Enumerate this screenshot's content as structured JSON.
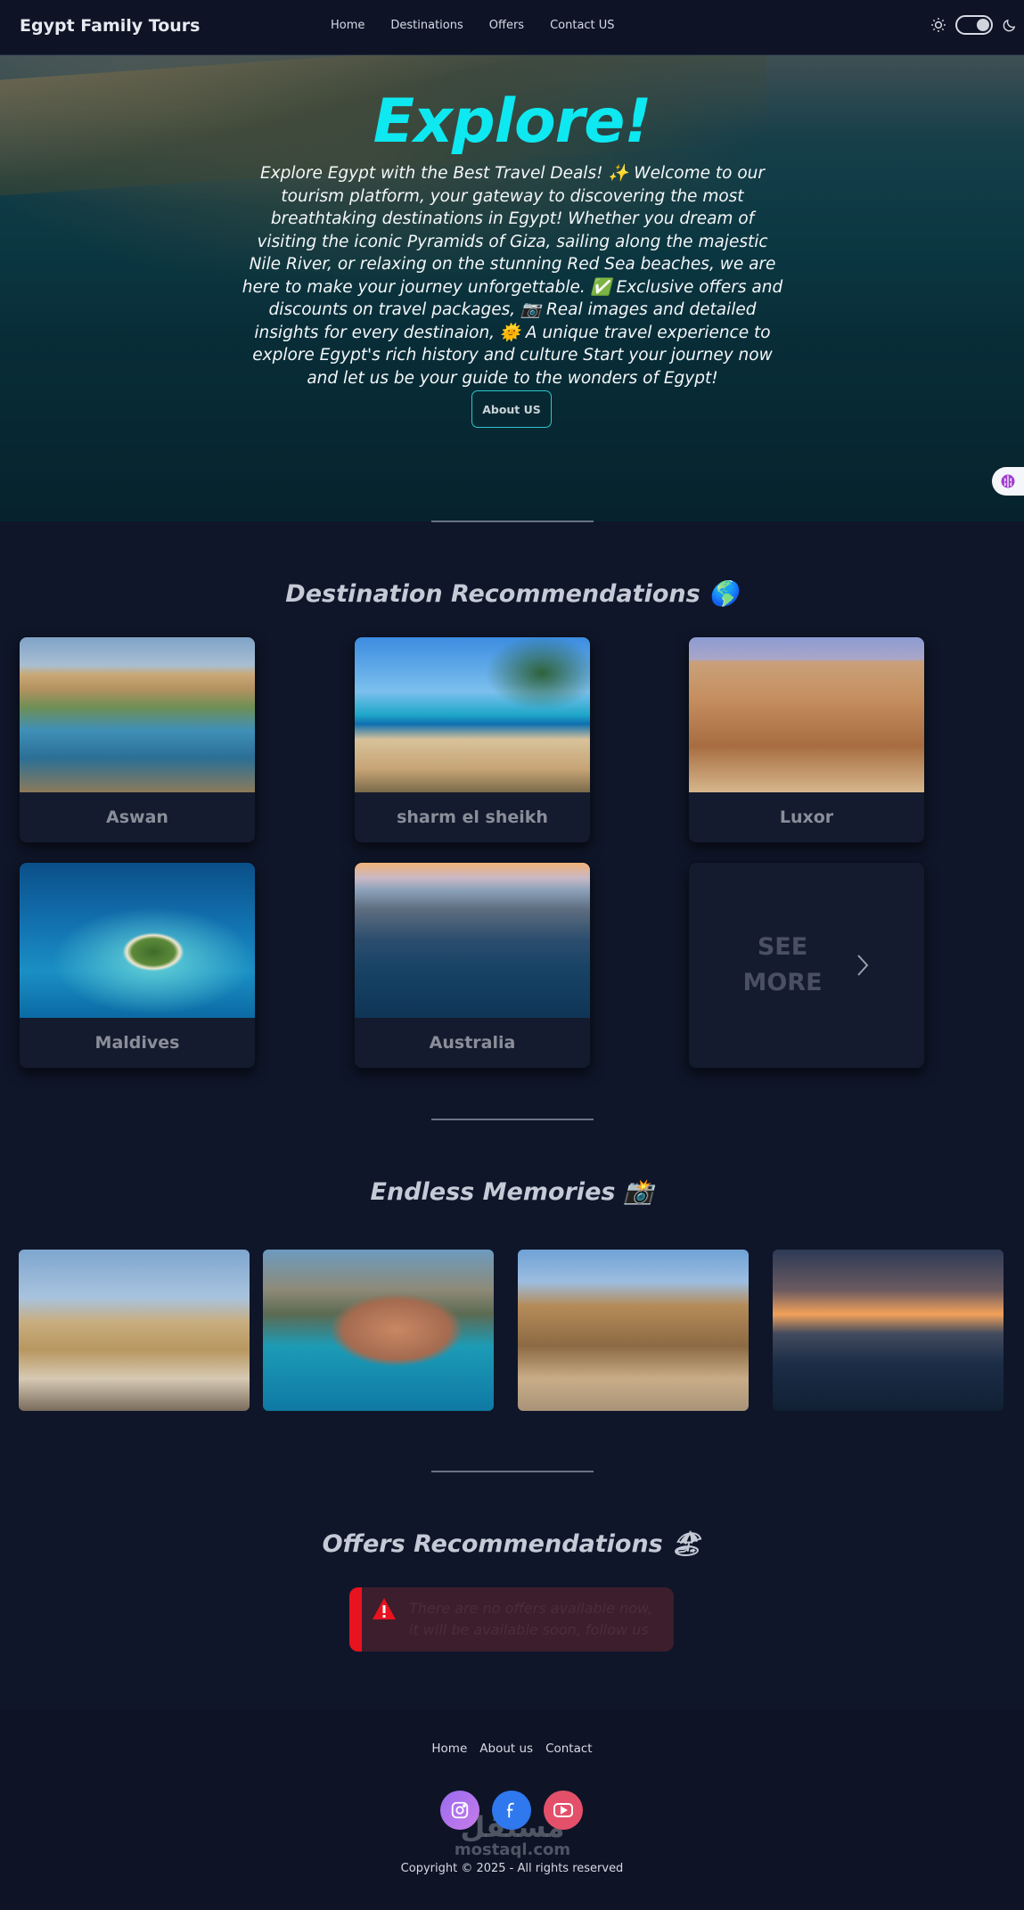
{
  "nav": {
    "brand": "Egypt Family Tours",
    "links": [
      "Home",
      "Destinations",
      "Offers",
      "Contact US"
    ],
    "theme_toggle": {
      "state": "dark",
      "left_icon": "sun-icon",
      "right_icon": "moon-icon"
    }
  },
  "hero": {
    "title": "Explore!",
    "text": "Explore Egypt with the Best Travel Deals! ✨ Welcome to our tourism platform, your gateway to discovering the most breathtaking destinations in Egypt! Whether you dream of visiting the iconic Pyramids of Giza, sailing along the majestic Nile River, or relaxing on the stunning Red Sea beaches, we are here to make your journey unforgettable. ✅ Exclusive offers and discounts on travel packages, 📷 Real images and detailed insights for every destinaion, 🌞 A unique travel experience to explore Egypt's rich history and culture Start your journey now and let us be your guide to the wonders of Egypt!",
    "button": "About US"
  },
  "destinations": {
    "title": "Destination Recommendations 🌎",
    "cards": [
      {
        "name": "Aswan",
        "image": "aswan-photo"
      },
      {
        "name": "sharm el sheikh",
        "image": "sharm-photo"
      },
      {
        "name": "Luxor",
        "image": "luxor-photo"
      },
      {
        "name": "Maldives",
        "image": "maldives-photo"
      },
      {
        "name": "Australia",
        "image": "australia-photo"
      }
    ],
    "see_more_line1": "SEE",
    "see_more_line2": "MORE"
  },
  "memories": {
    "title": "Endless Memories 📸",
    "images": [
      "pyramids-sphinx-photo",
      "coastal-town-photo",
      "temple-ruins-photo",
      "city-river-sunset-photo"
    ]
  },
  "offers": {
    "title": "Offers Recommendations 🏖",
    "empty_line1": "There are no offers available now,",
    "empty_line2": "it will be available soon, follow us"
  },
  "footer": {
    "links": [
      "Home",
      "About us",
      "Contact"
    ],
    "social": [
      "instagram-icon",
      "facebook-icon",
      "youtube-icon"
    ],
    "copyright": "Copyright © 2025 - All rights reserved",
    "watermark_ar": "مستقل",
    "watermark_lat": "mostaql.com"
  },
  "colors": {
    "accent": "#0ee8f0",
    "background": "#0f1629",
    "alert_bar": "#e8131e"
  }
}
